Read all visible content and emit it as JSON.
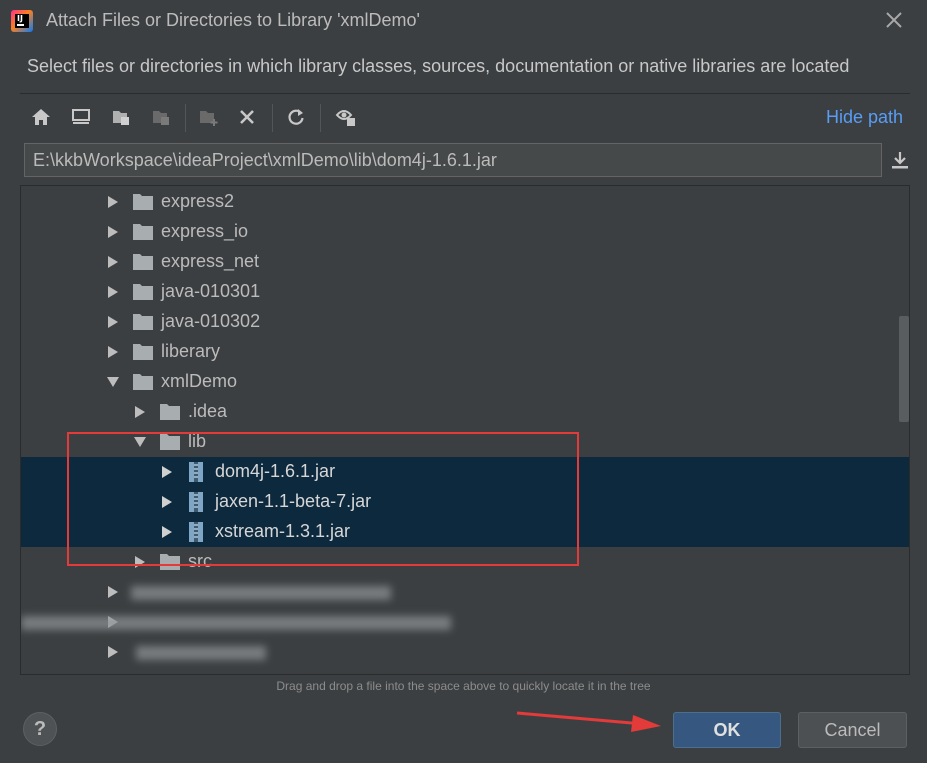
{
  "window": {
    "title": "Attach Files or Directories to Library 'xmlDemo'",
    "app_icon_text": "IJ",
    "close_icon": "close-icon"
  },
  "description": "Select files or directories in which library classes, sources, documentation or native libraries are located",
  "toolbar": {
    "icons": [
      "home-icon",
      "desktop-icon",
      "project-icon",
      "module-icon",
      "new-folder-icon",
      "delete-icon",
      "refresh-icon",
      "show-hidden-icon"
    ],
    "hide_path_label": "Hide path"
  },
  "path": {
    "value": "E:\\kkbWorkspace\\ideaProject\\xmlDemo\\lib\\dom4j-1.6.1.jar",
    "download_icon": "download-icon"
  },
  "tree": {
    "items": [
      {
        "label": "express2",
        "type": "folder",
        "expanded": false,
        "selected": false
      },
      {
        "label": "express_io",
        "type": "folder",
        "expanded": false,
        "selected": false
      },
      {
        "label": "express_net",
        "type": "folder",
        "expanded": false,
        "selected": false
      },
      {
        "label": "java-010301",
        "type": "folder",
        "expanded": false,
        "selected": false
      },
      {
        "label": "java-010302",
        "type": "folder",
        "expanded": false,
        "selected": false
      },
      {
        "label": "liberary",
        "type": "folder",
        "expanded": false,
        "selected": false
      },
      {
        "label": "xmlDemo",
        "type": "folder",
        "expanded": true,
        "selected": false
      },
      {
        "label": ".idea",
        "type": "folder",
        "expanded": false,
        "selected": false
      },
      {
        "label": "lib",
        "type": "folder",
        "expanded": true,
        "selected": false
      },
      {
        "label": "dom4j-1.6.1.jar",
        "type": "jar",
        "expanded": false,
        "selected": true
      },
      {
        "label": "jaxen-1.1-beta-7.jar",
        "type": "jar",
        "expanded": false,
        "selected": true
      },
      {
        "label": "xstream-1.3.1.jar",
        "type": "jar",
        "expanded": false,
        "selected": true
      },
      {
        "label": "src",
        "type": "folder",
        "expanded": false,
        "selected": false
      }
    ]
  },
  "hint": "Drag and drop a file into the space above to quickly locate it in the tree",
  "buttons": {
    "help": "?",
    "ok": "OK",
    "cancel": "Cancel"
  },
  "colors": {
    "background": "#3c3f41",
    "selection": "#0d293e",
    "accent_link": "#589df6",
    "ok_button": "#365880",
    "annotation_red": "#e33a3a"
  }
}
